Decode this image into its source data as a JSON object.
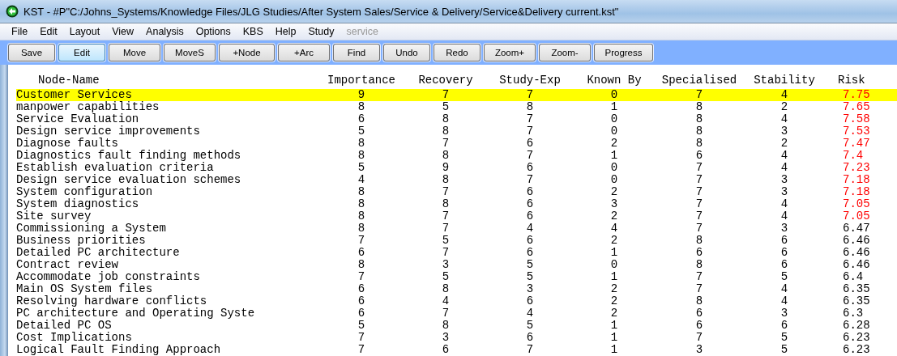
{
  "window": {
    "title": "KST - #P\"C:/Johns_Systems/Knowledge Files/JLG Studies/After System Sales/Service & Delivery/Service&Delivery current.kst\""
  },
  "menu": [
    {
      "label": "File",
      "disabled": false
    },
    {
      "label": "Edit",
      "disabled": false
    },
    {
      "label": "Layout",
      "disabled": false
    },
    {
      "label": "View",
      "disabled": false
    },
    {
      "label": "Analysis",
      "disabled": false
    },
    {
      "label": "Options",
      "disabled": false
    },
    {
      "label": "KBS",
      "disabled": false
    },
    {
      "label": "Help",
      "disabled": false
    },
    {
      "label": "Study",
      "disabled": false
    },
    {
      "label": "service",
      "disabled": true
    }
  ],
  "toolbar": [
    {
      "label": "Save",
      "focused": false
    },
    {
      "label": "Edit",
      "focused": true
    },
    {
      "label": "Move",
      "focused": false
    },
    {
      "label": "MoveS",
      "focused": false
    },
    {
      "label": "+Node",
      "focused": false
    },
    {
      "label": "+Arc",
      "focused": false
    },
    {
      "label": "Find",
      "focused": false
    },
    {
      "label": "Undo",
      "focused": false
    },
    {
      "label": "Redo",
      "focused": false
    },
    {
      "label": "Zoom+",
      "focused": false
    },
    {
      "label": "Zoom-",
      "focused": false
    },
    {
      "label": "Progress",
      "focused": false
    }
  ],
  "table": {
    "columns": [
      "Node-Name",
      "Importance",
      "Recovery",
      "Study-Exp",
      "Known By",
      "Specialised",
      "Stability",
      "Risk"
    ],
    "rows": [
      {
        "cells": [
          "Customer Services",
          "9",
          "7",
          "7",
          "0",
          "7",
          "4",
          "7.75"
        ],
        "selected": true,
        "high_risk": true
      },
      {
        "cells": [
          "manpower capabilities",
          "8",
          "5",
          "8",
          "1",
          "8",
          "2",
          "7.65"
        ],
        "selected": false,
        "high_risk": true
      },
      {
        "cells": [
          "Service Evaluation",
          "6",
          "8",
          "7",
          "0",
          "8",
          "4",
          "7.58"
        ],
        "selected": false,
        "high_risk": true
      },
      {
        "cells": [
          "Design service improvements",
          "5",
          "8",
          "7",
          "0",
          "8",
          "3",
          "7.53"
        ],
        "selected": false,
        "high_risk": true
      },
      {
        "cells": [
          "Diagnose faults",
          "8",
          "7",
          "6",
          "2",
          "8",
          "2",
          "7.47"
        ],
        "selected": false,
        "high_risk": true
      },
      {
        "cells": [
          "Diagnostics fault finding methods",
          "8",
          "8",
          "7",
          "1",
          "6",
          "4",
          "7.4"
        ],
        "selected": false,
        "high_risk": true
      },
      {
        "cells": [
          "Establish evaluation criteria",
          "5",
          "9",
          "6",
          "0",
          "7",
          "4",
          "7.23"
        ],
        "selected": false,
        "high_risk": true
      },
      {
        "cells": [
          "Design service evaluation schemes",
          "4",
          "8",
          "7",
          "0",
          "7",
          "3",
          "7.18"
        ],
        "selected": false,
        "high_risk": true
      },
      {
        "cells": [
          "System configuration",
          "8",
          "7",
          "6",
          "2",
          "7",
          "3",
          "7.18"
        ],
        "selected": false,
        "high_risk": true
      },
      {
        "cells": [
          "System diagnostics",
          "8",
          "8",
          "6",
          "3",
          "7",
          "4",
          "7.05"
        ],
        "selected": false,
        "high_risk": true
      },
      {
        "cells": [
          "Site survey",
          "8",
          "7",
          "6",
          "2",
          "7",
          "4",
          "7.05"
        ],
        "selected": false,
        "high_risk": true
      },
      {
        "cells": [
          "Commissioning a System",
          "8",
          "7",
          "4",
          "4",
          "7",
          "3",
          "6.47"
        ],
        "selected": false,
        "high_risk": false
      },
      {
        "cells": [
          "Business priorities",
          "7",
          "5",
          "6",
          "2",
          "8",
          "6",
          "6.46"
        ],
        "selected": false,
        "high_risk": false
      },
      {
        "cells": [
          "Detailed PC architecture",
          "6",
          "7",
          "6",
          "1",
          "6",
          "6",
          "6.46"
        ],
        "selected": false,
        "high_risk": false
      },
      {
        "cells": [
          "Contract review",
          "8",
          "3",
          "5",
          "0",
          "8",
          "6",
          "6.46"
        ],
        "selected": false,
        "high_risk": false
      },
      {
        "cells": [
          "Accommodate job constraints",
          "7",
          "5",
          "5",
          "1",
          "7",
          "5",
          "6.4"
        ],
        "selected": false,
        "high_risk": false
      },
      {
        "cells": [
          "Main OS System files",
          "6",
          "8",
          "3",
          "2",
          "7",
          "4",
          "6.35"
        ],
        "selected": false,
        "high_risk": false
      },
      {
        "cells": [
          "Resolving hardware conflicts",
          "6",
          "4",
          "6",
          "2",
          "8",
          "4",
          "6.35"
        ],
        "selected": false,
        "high_risk": false
      },
      {
        "cells": [
          "PC architecture and Operating Syste",
          "6",
          "7",
          "4",
          "2",
          "6",
          "3",
          "6.3"
        ],
        "selected": false,
        "high_risk": false
      },
      {
        "cells": [
          "Detailed PC OS",
          "5",
          "8",
          "5",
          "1",
          "6",
          "6",
          "6.28"
        ],
        "selected": false,
        "high_risk": false
      },
      {
        "cells": [
          "Cost Implications",
          "7",
          "3",
          "6",
          "1",
          "7",
          "5",
          "6.23"
        ],
        "selected": false,
        "high_risk": false
      },
      {
        "cells": [
          "Logical Fault Finding Approach",
          "7",
          "6",
          "7",
          "1",
          "3",
          "5",
          "6.23"
        ],
        "selected": false,
        "high_risk": false
      }
    ]
  }
}
